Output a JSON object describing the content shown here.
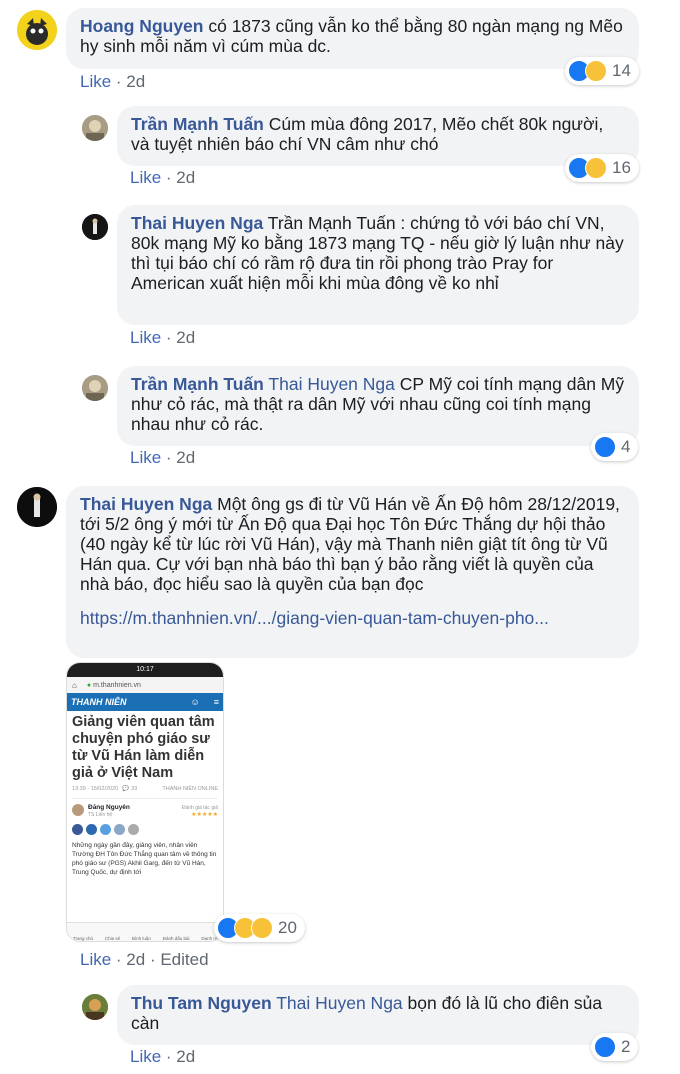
{
  "comments": [
    {
      "name": "Hoang Nguyen",
      "tag": "",
      "text": "có 1873 cũng vẫn ko thể bằng 80 ngàn mạng ng Mẽo hy sinh mỗi năm vì cúm mùa dc.",
      "meta": {
        "like": "Like",
        "time": "2d",
        "edited": ""
      },
      "reactions": {
        "count": "14",
        "icons": [
          "like-icon",
          "haha-icon"
        ]
      }
    },
    {
      "name": "Trần Mạnh Tuấn",
      "tag": "",
      "text": "Cúm mùa đông 2017, Mẽo chết 80k người, và tuyệt nhiên báo chí VN câm như chó",
      "meta": {
        "like": "Like",
        "time": "2d",
        "edited": ""
      },
      "reactions": {
        "count": "16",
        "icons": [
          "like-icon",
          "haha-icon"
        ]
      }
    },
    {
      "name": "Thai Huyen Nga",
      "tag": "",
      "text": "Trần Mạnh Tuấn : chứng tỏ với báo chí VN, 80k mạng Mỹ ko bằng 1873 mạng TQ - nếu giờ lý luận như này thì tụi báo chí có rầm rộ đưa tin rồi phong trào Pray for American xuất hiện mỗi khi mùa đông về ko nhỉ",
      "meta": {
        "like": "Like",
        "time": "2d",
        "edited": ""
      }
    },
    {
      "name": "Trần Mạnh Tuấn",
      "tag": "Thai Huyen Nga",
      "text": "CP Mỹ coi tính mạng dân Mỹ như cỏ rác, mà thật ra dân Mỹ với nhau cũng coi tính mạng nhau như cỏ rác.",
      "meta": {
        "like": "Like",
        "time": "2d",
        "edited": ""
      },
      "reactions": {
        "count": "4",
        "icons": [
          "like-icon"
        ]
      }
    },
    {
      "name": "Thai Huyen Nga",
      "tag": "",
      "text": "Một ông gs đi từ Vũ Hán về Ấn Độ hôm 28/12/2019, tới 5/2 ông ý mới từ Ấn Độ qua Đại học Tôn Đức Thắng dự hội thảo (40 ngày kể từ lúc rời Vũ Hán), vậy mà Thanh niên giật tít ông từ Vũ Hán qua. Cự với bạn nhà báo thì bạn ý bảo rằng viết là quyền của nhà báo, đọc hiểu sao là quyền của bạn đọc",
      "link": "https://m.thanhnien.vn/.../giang-vien-quan-tam-chuyen-pho...",
      "meta": {
        "like": "Like",
        "time": "2d",
        "edited": "Edited"
      },
      "reactions": {
        "count": "20",
        "icons": [
          "like-icon",
          "haha-icon",
          "wow-icon"
        ]
      }
    },
    {
      "name": "Thu Tam Nguyen",
      "tag": "Thai Huyen Nga",
      "text": "bọn đó là lũ cho điên sủa càn",
      "meta": {
        "like": "Like",
        "time": "2d",
        "edited": ""
      },
      "reactions": {
        "count": "2",
        "icons": [
          "like-icon"
        ]
      }
    }
  ],
  "attachment": {
    "status_time": "10:17",
    "url": "m.thanhnien.vn",
    "logo": "THANH NIÊN",
    "headline": "Giảng viên quan tâm chuyện phó giáo sư từ Vũ Hán làm diễn giả ở Việt Nam",
    "date": "13:39 - 15/02/2020",
    "comments": "33",
    "source": "THANH NIÊN ONLINE",
    "author": "Đăng Nguyên",
    "author_sub": "TS Liên hệ",
    "rating_label": "Đánh giá tác giả",
    "body": "Những ngày gần đây, giảng viên, nhân viên Trường ĐH Tôn Đức Thắng quan tâm về thông tin phó giáo sư (PGS) Akhil Garg, đến từ Vũ Hán, Trung Quốc, dự định tới",
    "nav": [
      "Trang chủ",
      "Chia sẻ",
      "Bình luận",
      "Đánh dấu bài",
      "Danh m"
    ]
  }
}
